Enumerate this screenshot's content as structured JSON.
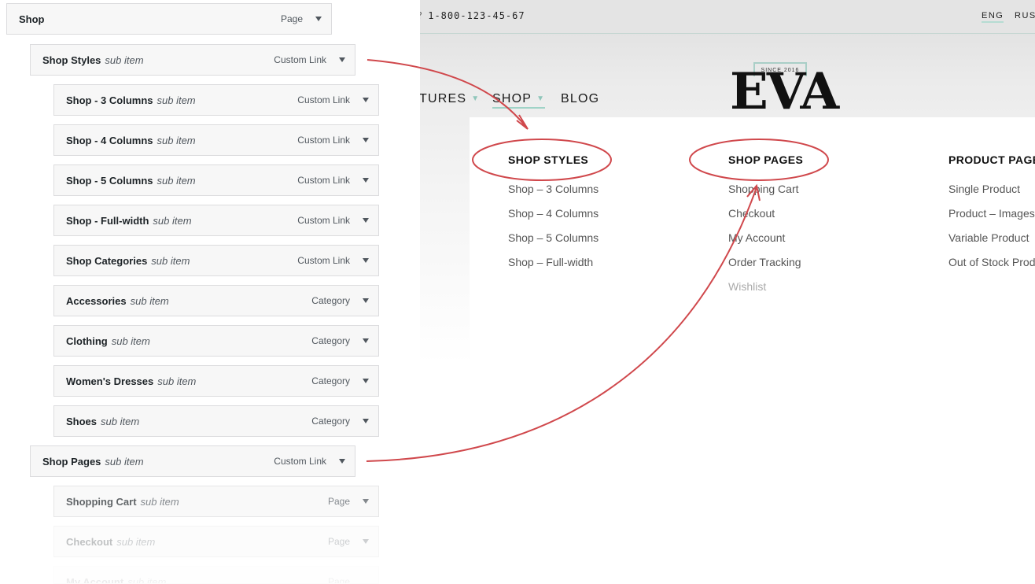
{
  "site": {
    "phone_prefix": "?",
    "phone": "1-800-123-45-67",
    "languages": [
      "ENG",
      "RUS"
    ],
    "nav": [
      {
        "label": "TURES",
        "has_dropdown": true
      },
      {
        "label": "SHOP",
        "has_dropdown": true
      },
      {
        "label": "BLOG",
        "has_dropdown": false
      }
    ],
    "logo": {
      "since": "SINCE 2016",
      "word": "EVA"
    },
    "mega_menu": {
      "columns": [
        {
          "title": "SHOP STYLES",
          "links": [
            "Shop – 3 Columns",
            "Shop – 4 Columns",
            "Shop – 5 Columns",
            "Shop – Full-width"
          ]
        },
        {
          "title": "SHOP PAGES",
          "links": [
            "Shopping Cart",
            "Checkout",
            "My Account",
            "Order Tracking",
            "Wishlist"
          ]
        },
        {
          "title": "PRODUCT PAGE",
          "links": [
            "Single Product",
            "Product – Images S",
            "Variable Product",
            "Out of Stock Produc"
          ]
        }
      ]
    }
  },
  "editor": {
    "items": [
      {
        "title": "Shop",
        "sub": "",
        "type": "Page"
      },
      {
        "title": "Shop Styles",
        "sub": "sub item",
        "type": "Custom Link"
      },
      {
        "title": "Shop - 3 Columns",
        "sub": "sub item",
        "type": "Custom Link"
      },
      {
        "title": "Shop - 4 Columns",
        "sub": "sub item",
        "type": "Custom Link"
      },
      {
        "title": "Shop - 5 Columns",
        "sub": "sub item",
        "type": "Custom Link"
      },
      {
        "title": "Shop - Full-width",
        "sub": "sub item",
        "type": "Custom Link"
      },
      {
        "title": "Shop Categories",
        "sub": "sub item",
        "type": "Custom Link"
      },
      {
        "title": "Accessories",
        "sub": "sub item",
        "type": "Category"
      },
      {
        "title": "Clothing",
        "sub": "sub item",
        "type": "Category"
      },
      {
        "title": "Women's Dresses",
        "sub": "sub item",
        "type": "Category"
      },
      {
        "title": "Shoes",
        "sub": "sub item",
        "type": "Category"
      },
      {
        "title": "Shop Pages",
        "sub": "sub item",
        "type": "Custom Link"
      },
      {
        "title": "Shopping Cart",
        "sub": "sub item",
        "type": "Page"
      },
      {
        "title": "Checkout",
        "sub": "sub item",
        "type": "Page"
      },
      {
        "title": "My Account",
        "sub": "sub item",
        "type": "Page"
      }
    ]
  },
  "colors": {
    "annotation": "#d0484c",
    "accent": "#9fd3c7"
  }
}
